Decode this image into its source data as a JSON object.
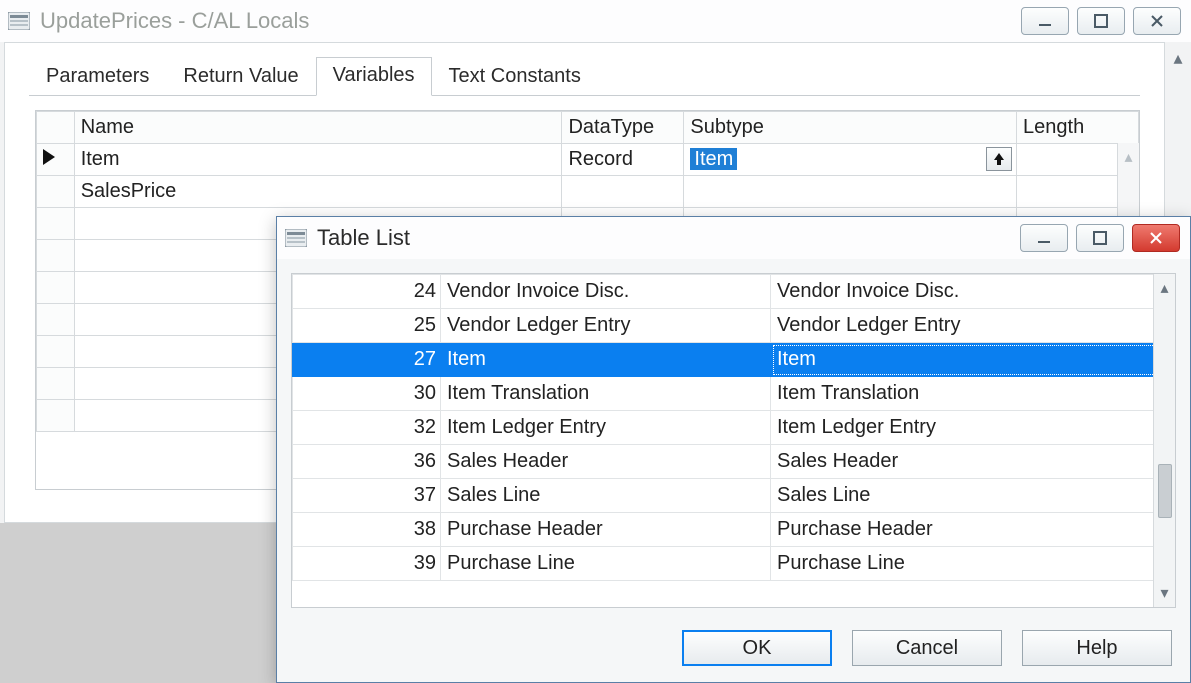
{
  "mainWindow": {
    "title": "UpdatePrices - C/AL Locals"
  },
  "tabs": [
    "Parameters",
    "Return Value",
    "Variables",
    "Text Constants"
  ],
  "activeTabIndex": 2,
  "varGrid": {
    "headers": {
      "name": "Name",
      "datatype": "DataType",
      "subtype": "Subtype",
      "length": "Length"
    },
    "rows": [
      {
        "current": true,
        "name": "Item",
        "datatype": "Record",
        "subtype": "Item",
        "length": ""
      },
      {
        "current": false,
        "name": "SalesPrice",
        "datatype": "",
        "subtype": "",
        "length": ""
      },
      {
        "current": false,
        "name": "",
        "datatype": "",
        "subtype": "",
        "length": ""
      },
      {
        "current": false,
        "name": "",
        "datatype": "",
        "subtype": "",
        "length": ""
      },
      {
        "current": false,
        "name": "",
        "datatype": "",
        "subtype": "",
        "length": ""
      },
      {
        "current": false,
        "name": "",
        "datatype": "",
        "subtype": "",
        "length": ""
      },
      {
        "current": false,
        "name": "",
        "datatype": "",
        "subtype": "",
        "length": ""
      },
      {
        "current": false,
        "name": "",
        "datatype": "",
        "subtype": "",
        "length": ""
      },
      {
        "current": false,
        "name": "",
        "datatype": "",
        "subtype": "",
        "length": ""
      }
    ]
  },
  "tableList": {
    "title": "Table List",
    "selectedId": 27,
    "rows": [
      {
        "id": 24,
        "name": "Vendor Invoice Disc.",
        "caption": "Vendor Invoice Disc."
      },
      {
        "id": 25,
        "name": "Vendor Ledger Entry",
        "caption": "Vendor Ledger Entry"
      },
      {
        "id": 27,
        "name": "Item",
        "caption": "Item"
      },
      {
        "id": 30,
        "name": "Item Translation",
        "caption": "Item Translation"
      },
      {
        "id": 32,
        "name": "Item Ledger Entry",
        "caption": "Item Ledger Entry"
      },
      {
        "id": 36,
        "name": "Sales Header",
        "caption": "Sales Header"
      },
      {
        "id": 37,
        "name": "Sales Line",
        "caption": "Sales Line"
      },
      {
        "id": 38,
        "name": "Purchase Header",
        "caption": "Purchase Header"
      },
      {
        "id": 39,
        "name": "Purchase Line",
        "caption": "Purchase Line"
      }
    ],
    "buttons": {
      "ok": "OK",
      "cancel": "Cancel",
      "help": "Help"
    }
  }
}
